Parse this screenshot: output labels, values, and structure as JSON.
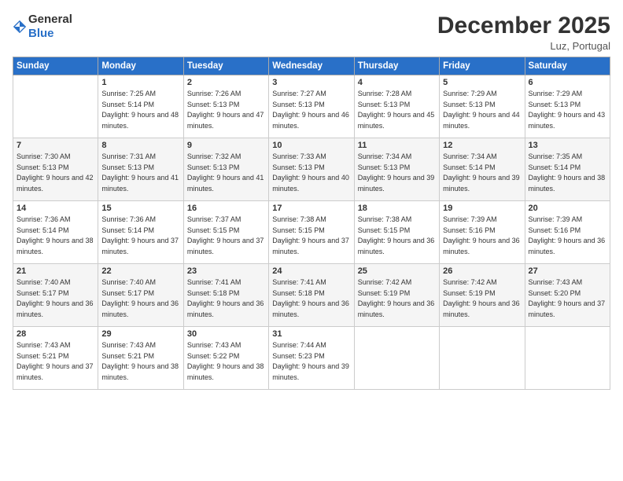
{
  "header": {
    "logo_general": "General",
    "logo_blue": "Blue",
    "title": "December 2025",
    "location": "Luz, Portugal"
  },
  "weekdays": [
    "Sunday",
    "Monday",
    "Tuesday",
    "Wednesday",
    "Thursday",
    "Friday",
    "Saturday"
  ],
  "weeks": [
    [
      {
        "day": "",
        "sunrise": "",
        "sunset": "",
        "daylight": ""
      },
      {
        "day": "1",
        "sunrise": "Sunrise: 7:25 AM",
        "sunset": "Sunset: 5:14 PM",
        "daylight": "Daylight: 9 hours and 48 minutes."
      },
      {
        "day": "2",
        "sunrise": "Sunrise: 7:26 AM",
        "sunset": "Sunset: 5:13 PM",
        "daylight": "Daylight: 9 hours and 47 minutes."
      },
      {
        "day": "3",
        "sunrise": "Sunrise: 7:27 AM",
        "sunset": "Sunset: 5:13 PM",
        "daylight": "Daylight: 9 hours and 46 minutes."
      },
      {
        "day": "4",
        "sunrise": "Sunrise: 7:28 AM",
        "sunset": "Sunset: 5:13 PM",
        "daylight": "Daylight: 9 hours and 45 minutes."
      },
      {
        "day": "5",
        "sunrise": "Sunrise: 7:29 AM",
        "sunset": "Sunset: 5:13 PM",
        "daylight": "Daylight: 9 hours and 44 minutes."
      },
      {
        "day": "6",
        "sunrise": "Sunrise: 7:29 AM",
        "sunset": "Sunset: 5:13 PM",
        "daylight": "Daylight: 9 hours and 43 minutes."
      }
    ],
    [
      {
        "day": "7",
        "sunrise": "Sunrise: 7:30 AM",
        "sunset": "Sunset: 5:13 PM",
        "daylight": "Daylight: 9 hours and 42 minutes."
      },
      {
        "day": "8",
        "sunrise": "Sunrise: 7:31 AM",
        "sunset": "Sunset: 5:13 PM",
        "daylight": "Daylight: 9 hours and 41 minutes."
      },
      {
        "day": "9",
        "sunrise": "Sunrise: 7:32 AM",
        "sunset": "Sunset: 5:13 PM",
        "daylight": "Daylight: 9 hours and 41 minutes."
      },
      {
        "day": "10",
        "sunrise": "Sunrise: 7:33 AM",
        "sunset": "Sunset: 5:13 PM",
        "daylight": "Daylight: 9 hours and 40 minutes."
      },
      {
        "day": "11",
        "sunrise": "Sunrise: 7:34 AM",
        "sunset": "Sunset: 5:13 PM",
        "daylight": "Daylight: 9 hours and 39 minutes."
      },
      {
        "day": "12",
        "sunrise": "Sunrise: 7:34 AM",
        "sunset": "Sunset: 5:14 PM",
        "daylight": "Daylight: 9 hours and 39 minutes."
      },
      {
        "day": "13",
        "sunrise": "Sunrise: 7:35 AM",
        "sunset": "Sunset: 5:14 PM",
        "daylight": "Daylight: 9 hours and 38 minutes."
      }
    ],
    [
      {
        "day": "14",
        "sunrise": "Sunrise: 7:36 AM",
        "sunset": "Sunset: 5:14 PM",
        "daylight": "Daylight: 9 hours and 38 minutes."
      },
      {
        "day": "15",
        "sunrise": "Sunrise: 7:36 AM",
        "sunset": "Sunset: 5:14 PM",
        "daylight": "Daylight: 9 hours and 37 minutes."
      },
      {
        "day": "16",
        "sunrise": "Sunrise: 7:37 AM",
        "sunset": "Sunset: 5:15 PM",
        "daylight": "Daylight: 9 hours and 37 minutes."
      },
      {
        "day": "17",
        "sunrise": "Sunrise: 7:38 AM",
        "sunset": "Sunset: 5:15 PM",
        "daylight": "Daylight: 9 hours and 37 minutes."
      },
      {
        "day": "18",
        "sunrise": "Sunrise: 7:38 AM",
        "sunset": "Sunset: 5:15 PM",
        "daylight": "Daylight: 9 hours and 36 minutes."
      },
      {
        "day": "19",
        "sunrise": "Sunrise: 7:39 AM",
        "sunset": "Sunset: 5:16 PM",
        "daylight": "Daylight: 9 hours and 36 minutes."
      },
      {
        "day": "20",
        "sunrise": "Sunrise: 7:39 AM",
        "sunset": "Sunset: 5:16 PM",
        "daylight": "Daylight: 9 hours and 36 minutes."
      }
    ],
    [
      {
        "day": "21",
        "sunrise": "Sunrise: 7:40 AM",
        "sunset": "Sunset: 5:17 PM",
        "daylight": "Daylight: 9 hours and 36 minutes."
      },
      {
        "day": "22",
        "sunrise": "Sunrise: 7:40 AM",
        "sunset": "Sunset: 5:17 PM",
        "daylight": "Daylight: 9 hours and 36 minutes."
      },
      {
        "day": "23",
        "sunrise": "Sunrise: 7:41 AM",
        "sunset": "Sunset: 5:18 PM",
        "daylight": "Daylight: 9 hours and 36 minutes."
      },
      {
        "day": "24",
        "sunrise": "Sunrise: 7:41 AM",
        "sunset": "Sunset: 5:18 PM",
        "daylight": "Daylight: 9 hours and 36 minutes."
      },
      {
        "day": "25",
        "sunrise": "Sunrise: 7:42 AM",
        "sunset": "Sunset: 5:19 PM",
        "daylight": "Daylight: 9 hours and 36 minutes."
      },
      {
        "day": "26",
        "sunrise": "Sunrise: 7:42 AM",
        "sunset": "Sunset: 5:19 PM",
        "daylight": "Daylight: 9 hours and 36 minutes."
      },
      {
        "day": "27",
        "sunrise": "Sunrise: 7:43 AM",
        "sunset": "Sunset: 5:20 PM",
        "daylight": "Daylight: 9 hours and 37 minutes."
      }
    ],
    [
      {
        "day": "28",
        "sunrise": "Sunrise: 7:43 AM",
        "sunset": "Sunset: 5:21 PM",
        "daylight": "Daylight: 9 hours and 37 minutes."
      },
      {
        "day": "29",
        "sunrise": "Sunrise: 7:43 AM",
        "sunset": "Sunset: 5:21 PM",
        "daylight": "Daylight: 9 hours and 38 minutes."
      },
      {
        "day": "30",
        "sunrise": "Sunrise: 7:43 AM",
        "sunset": "Sunset: 5:22 PM",
        "daylight": "Daylight: 9 hours and 38 minutes."
      },
      {
        "day": "31",
        "sunrise": "Sunrise: 7:44 AM",
        "sunset": "Sunset: 5:23 PM",
        "daylight": "Daylight: 9 hours and 39 minutes."
      },
      {
        "day": "",
        "sunrise": "",
        "sunset": "",
        "daylight": ""
      },
      {
        "day": "",
        "sunrise": "",
        "sunset": "",
        "daylight": ""
      },
      {
        "day": "",
        "sunrise": "",
        "sunset": "",
        "daylight": ""
      }
    ]
  ]
}
